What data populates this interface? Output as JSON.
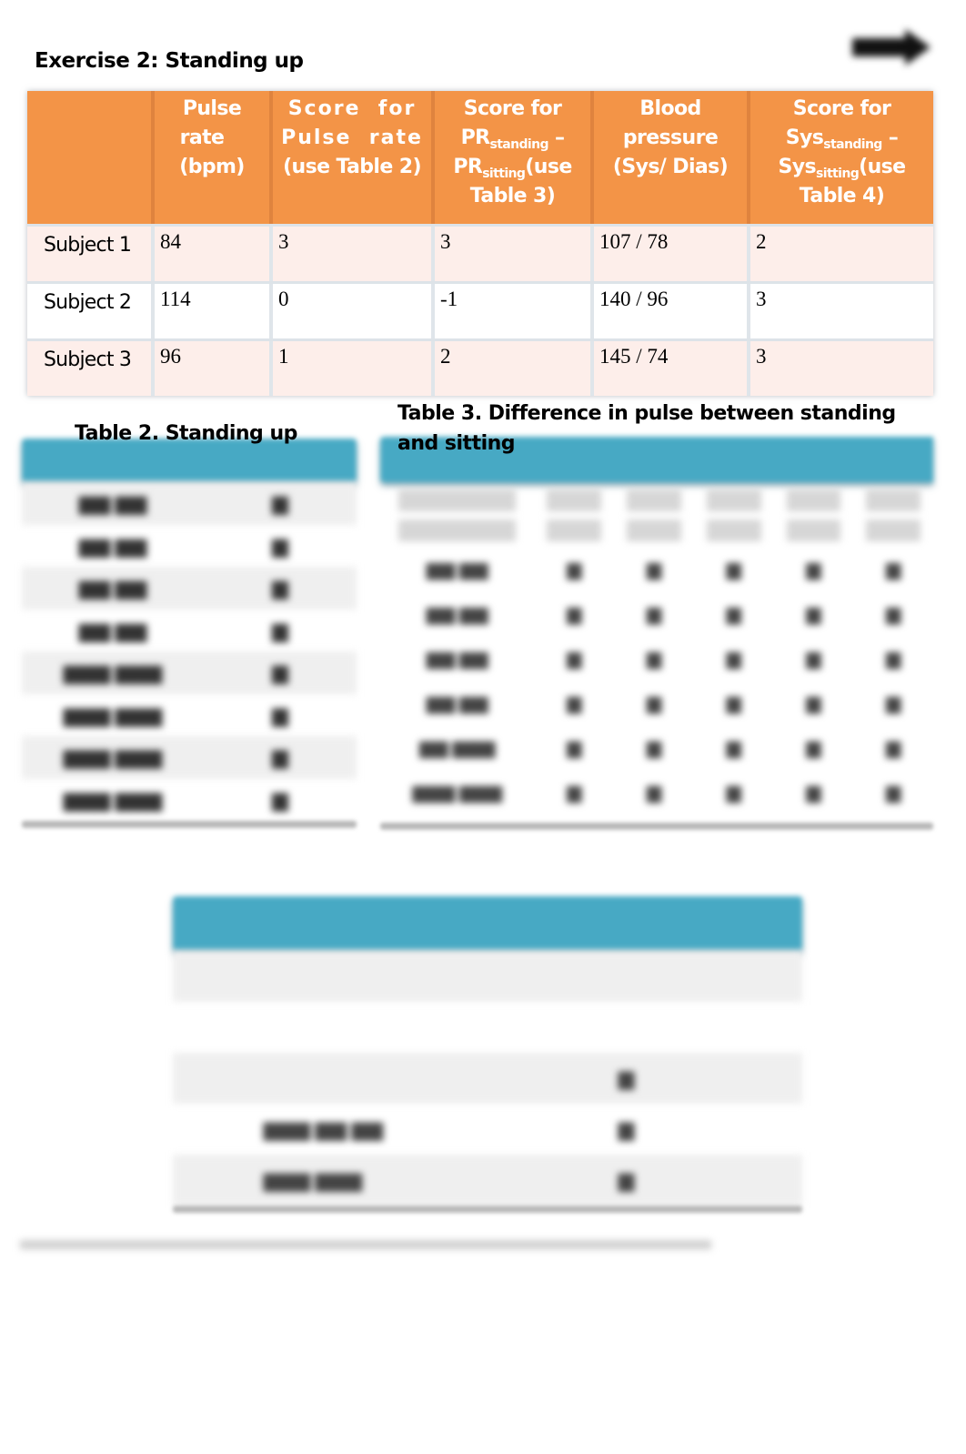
{
  "page": {
    "title_obscured": true,
    "next_arrow_icon": "arrow-right-icon"
  },
  "exercise": {
    "title": "Exercise 2: Standing up",
    "colors": {
      "header": "#f39447",
      "row_tint": "#fdeeea",
      "header_text": "#ffffff"
    },
    "headers": [
      {
        "line1": ""
      },
      {
        "line1": "Pulse",
        "line2": "rate",
        "line3": "(bpm)"
      },
      {
        "line1": "Score  for",
        "line2": "Pulse  rate",
        "line3": "(use Table 2)"
      },
      {
        "line1": "Score for",
        "pr": "PR",
        "sub1": "standing",
        "dash": " –",
        "pr2": "PR",
        "sub2": "sitting",
        "use": "(use",
        "line4": "Table 3)"
      },
      {
        "line1": "Blood",
        "line2": "pressure",
        "line3": "(Sys/ Dias)"
      },
      {
        "line1": "Score for",
        "pr": "Sys",
        "sub1": "standing",
        "dash": " –",
        "pr2": "Sys",
        "sub2": "sitting",
        "use": "(use",
        "line4": "Table 4)"
      }
    ],
    "rows": [
      {
        "subject": "Subject 1",
        "pulse": "84",
        "pulse_score": "3",
        "pr_score": "3",
        "bp": "107 / 78",
        "sys_score": "2"
      },
      {
        "subject": "Subject 2",
        "pulse": "114",
        "pulse_score": "0",
        "pr_score": "-1",
        "bp": "140 / 96",
        "sys_score": "3"
      },
      {
        "subject": "Subject 3",
        "pulse": "96",
        "pulse_score": "1",
        "pr_score": "2",
        "bp": "145 / 74",
        "sys_score": "3"
      }
    ]
  },
  "table2": {
    "caption": "Table 2. Standing up",
    "header_color": "#47a9c4",
    "content_obscured": true
  },
  "table3": {
    "caption": "Table 3. Difference in pulse between standing and sitting",
    "header_color": "#47a9c4",
    "content_obscured": true
  },
  "table4": {
    "header_color": "#47a9c4",
    "content_obscured": true
  }
}
